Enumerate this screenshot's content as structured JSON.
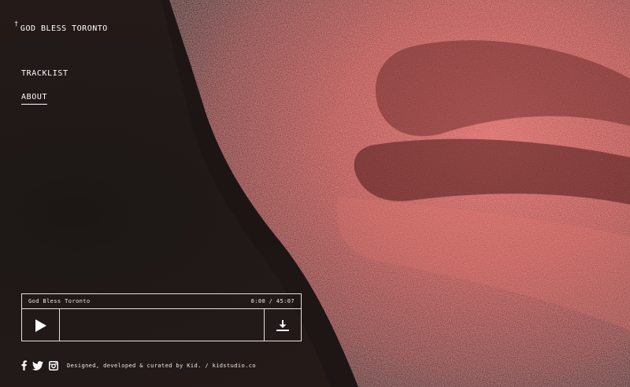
{
  "brand": {
    "mark": "†",
    "title": "GOD BLESS TORONTO"
  },
  "nav": {
    "items": [
      {
        "label": "TRACKLIST",
        "active": false
      },
      {
        "label": "ABOUT",
        "active": true
      }
    ]
  },
  "player": {
    "track_title": "God Bless Toronto",
    "time": "0:00 / 45:07",
    "progress": 0,
    "play_icon": "play-icon",
    "download_icon": "download-icon"
  },
  "footer": {
    "social": [
      {
        "name": "facebook-icon"
      },
      {
        "name": "twitter-icon"
      },
      {
        "name": "instagram-icon"
      }
    ],
    "credit": "Designed, developed & curated by Kid. / kidstudio.co"
  },
  "colors": {
    "shadow": "#1a1614",
    "skin": "#b8473f",
    "skin_highlight": "#d66a62",
    "line": "#e6e0dc"
  }
}
